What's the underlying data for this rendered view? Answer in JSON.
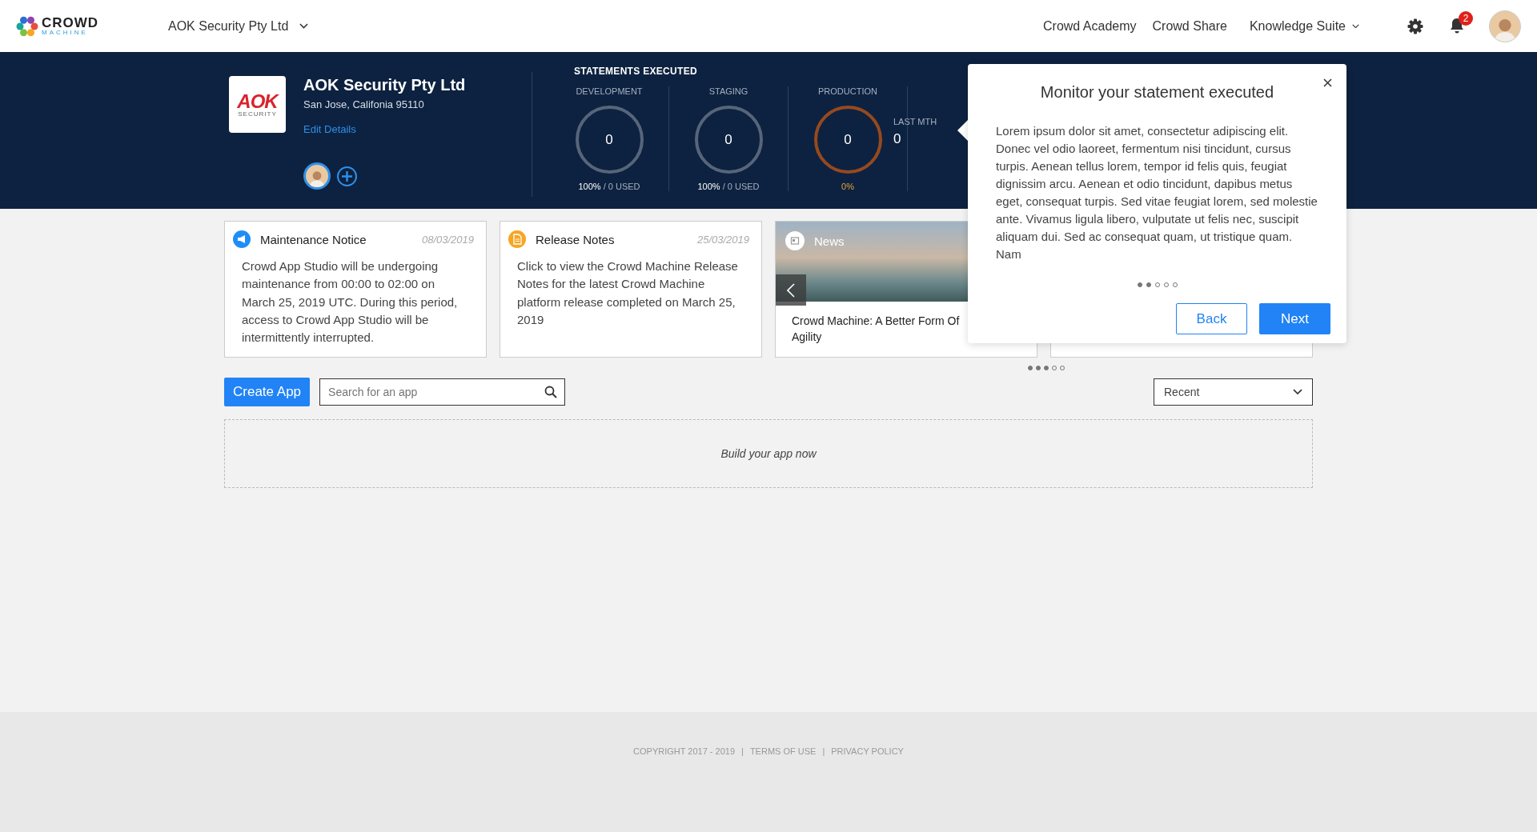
{
  "header": {
    "brand": "CROWD",
    "brand_sub": "MACHINE",
    "org": "AOK Security Pty Ltd",
    "nav": [
      "Crowd Academy",
      "Crowd Share"
    ],
    "menu": "Knowledge Suite",
    "notifications": "2"
  },
  "company": {
    "logo_text": "AOK",
    "logo_sub": "SECURITY",
    "name": "AOK Security Pty Ltd",
    "address": "San Jose, Califonia 95110",
    "link": "Edit Details"
  },
  "statements": {
    "title": "STATEMENTS EXECUTED",
    "stats": [
      {
        "kind": "quota",
        "label": "DEVELOPMENT",
        "value": "0",
        "usage": "**100%** / 0 USED",
        "color": "#56657a"
      },
      {
        "kind": "quota",
        "label": "STAGING",
        "value": "0",
        "usage": "**100%** / 0 USED",
        "color": "#56657a"
      },
      {
        "kind": "percent",
        "label": "PRODUCTION",
        "value": "0",
        "usage": "0%",
        "color": "#96491f"
      }
    ],
    "last_month": {
      "label": "LAST MTH",
      "value": "0"
    }
  },
  "cards": [
    {
      "kind": "maintenance",
      "title": "Maintenance Notice",
      "date": "08/03/2019",
      "body": "Crowd App Studio will be undergoing maintenance from 00:00 to 02:00 on March 25, 2019 UTC. During this period, access to Crowd App Studio will be intermittently interrupted."
    },
    {
      "kind": "release",
      "title": "Release Notes",
      "date": "25/03/2019",
      "body": "Click to view the Crowd Machine Release Notes for the latest Crowd Machine platform release completed on March 25, 2019"
    },
    {
      "kind": "news",
      "tag": "News",
      "title": "Crowd Machine: A Better Form Of Agility"
    },
    {
      "kind": "blank"
    }
  ],
  "carousel_dots": [
    {
      "filled": true
    },
    {
      "filled": true
    },
    {
      "filled": true
    },
    {
      "filled": false
    },
    {
      "filled": false
    }
  ],
  "toolbar": {
    "create": "Create App",
    "search_placeholder": "Search for an app",
    "sort": "Recent"
  },
  "empty": "Build your app now",
  "footer": {
    "items": [
      "COPYRIGHT 2017 - 2019",
      "TERMS OF USE",
      "PRIVACY POLICY"
    ],
    "separators": [
      "|",
      "|"
    ]
  },
  "tour": {
    "title": "Monitor your statement executed",
    "body": "Lorem ipsum dolor sit amet, consectetur adipiscing elit. Donec vel odio laoreet, fermentum nisi tincidunt, cursus turpis. Aenean tellus lorem, tempor id felis quis, feugiat dignissim arcu. Aenean et odio tincidunt, dapibus metus eget, consequat turpis. Sed vitae feugiat lorem, sed molestie ante. Vivamus ligula libero, vulputate ut felis nec, suscipit aliquam dui. Sed ac consequat quam, ut tristique quam. Nam",
    "dots": [
      {
        "filled": true
      },
      {
        "filled": true
      },
      {
        "filled": false
      },
      {
        "filled": false
      },
      {
        "filled": false
      }
    ],
    "back": "Back",
    "next": "Next"
  }
}
